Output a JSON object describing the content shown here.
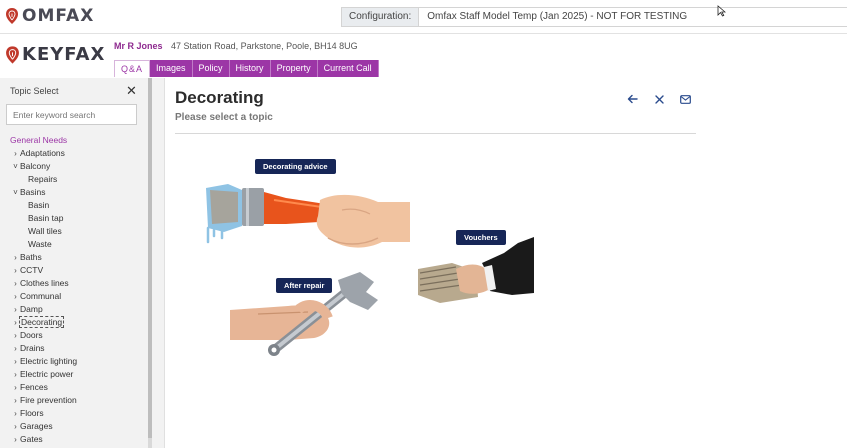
{
  "top": {
    "brand": "OMFAX",
    "config_label": "Configuration:",
    "config_value": "Omfax Staff Model Temp (Jan 2025) - NOT FOR TESTING"
  },
  "header": {
    "brand": "KEYFAX",
    "customer_name": "Mr R Jones",
    "customer_address": "47 Station Road, Parkstone, Poole, BH14 8UG",
    "tabs": [
      "Q&A",
      "Images",
      "Policy",
      "History",
      "Property",
      "Current Call"
    ]
  },
  "sidebar": {
    "title": "Topic Select",
    "search_placeholder": "Enter keyword search",
    "root": "General Needs",
    "items": [
      {
        "label": "Adaptations",
        "level": 1,
        "expanded": false
      },
      {
        "label": "Balcony",
        "level": 1,
        "expanded": true
      },
      {
        "label": "Repairs",
        "level": 2
      },
      {
        "label": "Basins",
        "level": 1,
        "expanded": true
      },
      {
        "label": "Basin",
        "level": 2
      },
      {
        "label": "Basin tap",
        "level": 2
      },
      {
        "label": "Wall tiles",
        "level": 2
      },
      {
        "label": "Waste",
        "level": 2
      },
      {
        "label": "Baths",
        "level": 1,
        "expanded": false
      },
      {
        "label": "CCTV",
        "level": 1,
        "expanded": false
      },
      {
        "label": "Clothes lines",
        "level": 1,
        "expanded": false
      },
      {
        "label": "Communal",
        "level": 1,
        "expanded": false
      },
      {
        "label": "Damp",
        "level": 1,
        "expanded": false
      },
      {
        "label": "Decorating",
        "level": 1,
        "expanded": false,
        "selected": true
      },
      {
        "label": "Doors",
        "level": 1,
        "expanded": false
      },
      {
        "label": "Drains",
        "level": 1,
        "expanded": false
      },
      {
        "label": "Electric lighting",
        "level": 1,
        "expanded": false
      },
      {
        "label": "Electric power",
        "level": 1,
        "expanded": false
      },
      {
        "label": "Fences",
        "level": 1,
        "expanded": false
      },
      {
        "label": "Fire prevention",
        "level": 1,
        "expanded": false
      },
      {
        "label": "Floors",
        "level": 1,
        "expanded": false
      },
      {
        "label": "Garages",
        "level": 1,
        "expanded": false
      },
      {
        "label": "Gates",
        "level": 1,
        "expanded": false
      }
    ]
  },
  "main": {
    "title": "Decorating",
    "subtitle": "Please select a topic",
    "options": {
      "decorating_advice": "Decorating advice",
      "vouchers": "Vouchers",
      "after_repair": "After repair"
    }
  },
  "colors": {
    "accent": "#9c36a6",
    "chip": "#162657",
    "action_icons": "#2a4b8d"
  },
  "icons": [
    "back-arrow-icon",
    "close-icon",
    "mail-icon",
    "cursor-icon",
    "fingerprint-icon"
  ]
}
